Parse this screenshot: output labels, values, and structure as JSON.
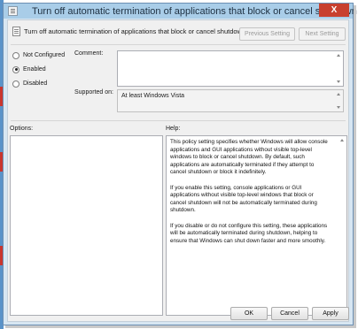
{
  "window": {
    "title": "Turn off automatic termination of applications that block or cancel shutdown",
    "close_label": "X"
  },
  "header": {
    "setting_name": "Turn off automatic termination of applications that block or cancel shutdown",
    "previous_label": "Previous Setting",
    "next_label": "Next Setting"
  },
  "state": {
    "options": [
      {
        "label": "Not Configured",
        "checked": false
      },
      {
        "label": "Enabled",
        "checked": true
      },
      {
        "label": "Disabled",
        "checked": false
      }
    ]
  },
  "comment": {
    "label": "Comment:",
    "value": ""
  },
  "supported": {
    "label": "Supported on:",
    "value": "At least Windows Vista"
  },
  "panels": {
    "options_label": "Options:",
    "help_label": "Help:"
  },
  "help": {
    "p1_lines": [
      "This policy setting specifies whether Windows will allow console",
      "applications and GUI applications without visible top-level",
      "windows to block or cancel shutdown. By default, such",
      "applications are automatically terminated if they attempt to",
      "cancel shutdown or block it indefinitely."
    ],
    "p2_lines": [
      "If you enable this setting, console applications or GUI",
      "applications without visible top-level windows that block or",
      "cancel shutdown will not be automatically terminated during",
      "shutdown."
    ],
    "p3_lines": [
      "If you disable or do not configure this setting, these applications",
      "will be automatically terminated during shutdown, helping to",
      "ensure that Windows can shut down faster and more smoothly."
    ]
  },
  "footer": {
    "ok_label": "OK",
    "cancel_label": "Cancel",
    "apply_label": "Apply"
  },
  "colors": {
    "titlebar": "#a9cde8",
    "close_button": "#c8402f",
    "client_background": "#f0f0f0"
  }
}
